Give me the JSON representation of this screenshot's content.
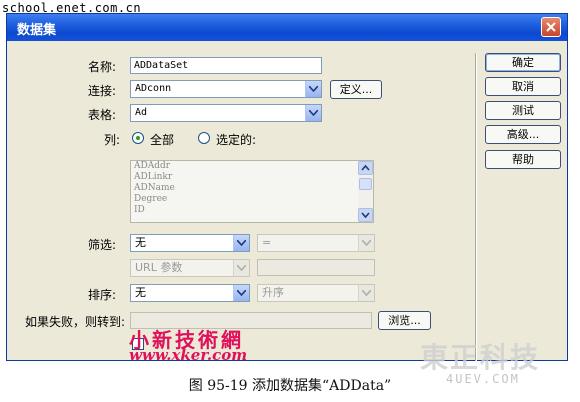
{
  "site_watermark": "school.enet.com.cn",
  "window": {
    "title": "数据集"
  },
  "form": {
    "name_label": "名称:",
    "name_value": "ADDataSet",
    "connection_label": "连接:",
    "connection_value": "ADconn",
    "define_button": "定义...",
    "table_label": "表格:",
    "table_value": "Ad",
    "columns_label": "列:",
    "radio_all": "全部",
    "radio_selected": "选定的:",
    "column_items": [
      "ADAddr",
      "ADLinkr",
      "ADName",
      "Degree",
      "ID"
    ],
    "filter_label": "筛选:",
    "filter_value": "无",
    "filter_operator": "=",
    "filter_param_value": "URL 参数",
    "sort_label": "排序:",
    "sort_value": "无",
    "sort_order_value": "升序",
    "on_fail_label": "如果失败，则转到:",
    "browse_button": "浏览..."
  },
  "side_buttons": [
    "确定",
    "取消",
    "测试",
    "高级...",
    "帮助"
  ],
  "overlay_watermark": {
    "line1": "小新技術網",
    "line2": "www.xker.com"
  },
  "brand_watermark": {
    "main": "東正科技",
    "sub": "4UEV.COM"
  },
  "caption": "图 95-19    添加数据集“ADData”",
  "colors": {
    "title_bar": "#2262e0",
    "dialog_bg": "#ece9d8",
    "radio_dot": "#21a121",
    "overlay_watermark": "#e0105a"
  }
}
